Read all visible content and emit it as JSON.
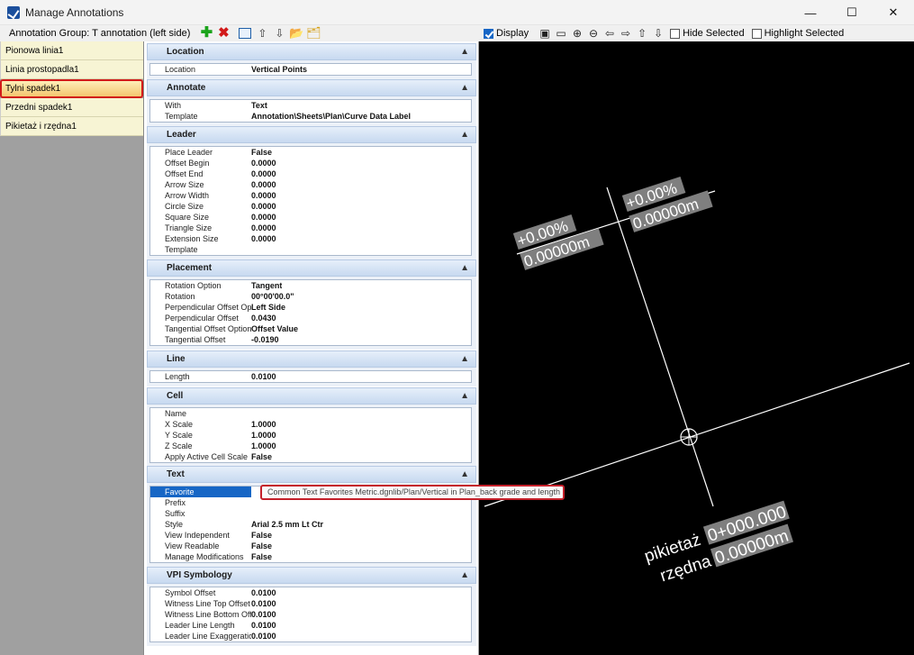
{
  "window": {
    "title": "Manage Annotations",
    "minimize": "—",
    "maximize": "☐",
    "close": "✕"
  },
  "toolbar_left": {
    "group_label": "Annotation Group: T annotation (left side)"
  },
  "toolbar_right": {
    "display_label": "Display",
    "display_checked": true,
    "hide_selected_label": "Hide Selected",
    "highlight_selected_label": "Highlight Selected"
  },
  "annotation_list": {
    "items": [
      {
        "label": "Pionowa linia1"
      },
      {
        "label": "Linia prostopadla1"
      },
      {
        "label": "Tylni spadek1"
      },
      {
        "label": "Przedni spadek1"
      },
      {
        "label": "Pikietaż i rzędna1"
      }
    ],
    "selected_index": 2
  },
  "sections": {
    "location": {
      "title": "Location",
      "rows": [
        {
          "label": "Location",
          "value": "Vertical Points"
        }
      ]
    },
    "annotate": {
      "title": "Annotate",
      "rows": [
        {
          "label": "With",
          "value": "Text"
        },
        {
          "label": "Template",
          "value": "Annotation\\Sheets\\Plan\\Curve Data Label"
        }
      ]
    },
    "leader": {
      "title": "Leader",
      "rows": [
        {
          "label": "Place Leader",
          "value": "False"
        },
        {
          "label": "Offset Begin",
          "value": "0.0000"
        },
        {
          "label": "Offset End",
          "value": "0.0000"
        },
        {
          "label": "Arrow Size",
          "value": "0.0000"
        },
        {
          "label": "Arrow Width",
          "value": "0.0000"
        },
        {
          "label": "Circle Size",
          "value": "0.0000"
        },
        {
          "label": "Square Size",
          "value": "0.0000"
        },
        {
          "label": "Triangle Size",
          "value": "0.0000"
        },
        {
          "label": "Extension Size",
          "value": "0.0000"
        },
        {
          "label": "Template",
          "value": ""
        }
      ]
    },
    "placement": {
      "title": "Placement",
      "rows": [
        {
          "label": "Rotation Option",
          "value": "Tangent"
        },
        {
          "label": "Rotation",
          "value": "00°00'00.0\""
        },
        {
          "label": "Perpendicular Offset Option",
          "value": "Left Side"
        },
        {
          "label": "Perpendicular Offset",
          "value": "0.0430"
        },
        {
          "label": "Tangential Offset Option",
          "value": "Offset Value"
        },
        {
          "label": "Tangential Offset",
          "value": "-0.0190"
        }
      ]
    },
    "line": {
      "title": "Line",
      "rows": [
        {
          "label": "Length",
          "value": "0.0100"
        }
      ]
    },
    "cell": {
      "title": "Cell",
      "rows": [
        {
          "label": "Name",
          "value": ""
        },
        {
          "label": "X Scale",
          "value": "1.0000"
        },
        {
          "label": "Y Scale",
          "value": "1.0000"
        },
        {
          "label": "Z Scale",
          "value": "1.0000"
        },
        {
          "label": "Apply Active Cell Scale",
          "value": "False"
        }
      ]
    },
    "text": {
      "title": "Text",
      "rows": [
        {
          "label": "Favorite",
          "value": "Common Text Favorites Metric.dgnlib/Plan/Vertical in Plan_back grade and length"
        },
        {
          "label": "Prefix",
          "value": ""
        },
        {
          "label": "Suffix",
          "value": ""
        },
        {
          "label": "Style",
          "value": "Arial 2.5 mm Lt Ctr"
        },
        {
          "label": "View Independent",
          "value": "False"
        },
        {
          "label": "View Readable",
          "value": "False"
        },
        {
          "label": "Manage Modifications",
          "value": "False"
        }
      ]
    },
    "vpi_symbology": {
      "title": "VPI Symbology",
      "rows": [
        {
          "label": "Symbol Offset",
          "value": "0.0100"
        },
        {
          "label": "Witness Line Top Offset",
          "value": "0.0100"
        },
        {
          "label": "Witness Line Bottom Offset",
          "value": "0.0100"
        },
        {
          "label": "Leader Line Length",
          "value": "0.0100"
        },
        {
          "label": "Leader Line Exaggeration",
          "value": "0.0100"
        }
      ]
    }
  },
  "graphics_view": {
    "labels": {
      "grade_left": "+0.00%",
      "length_left": "0.00000m",
      "grade_right": "+0.00%",
      "length_right": "0.00000m",
      "station_prefix": "pikietaż",
      "station_value": "0+000.000",
      "elevation_prefix": "rzędna",
      "elevation_value": "0.00000m"
    }
  }
}
